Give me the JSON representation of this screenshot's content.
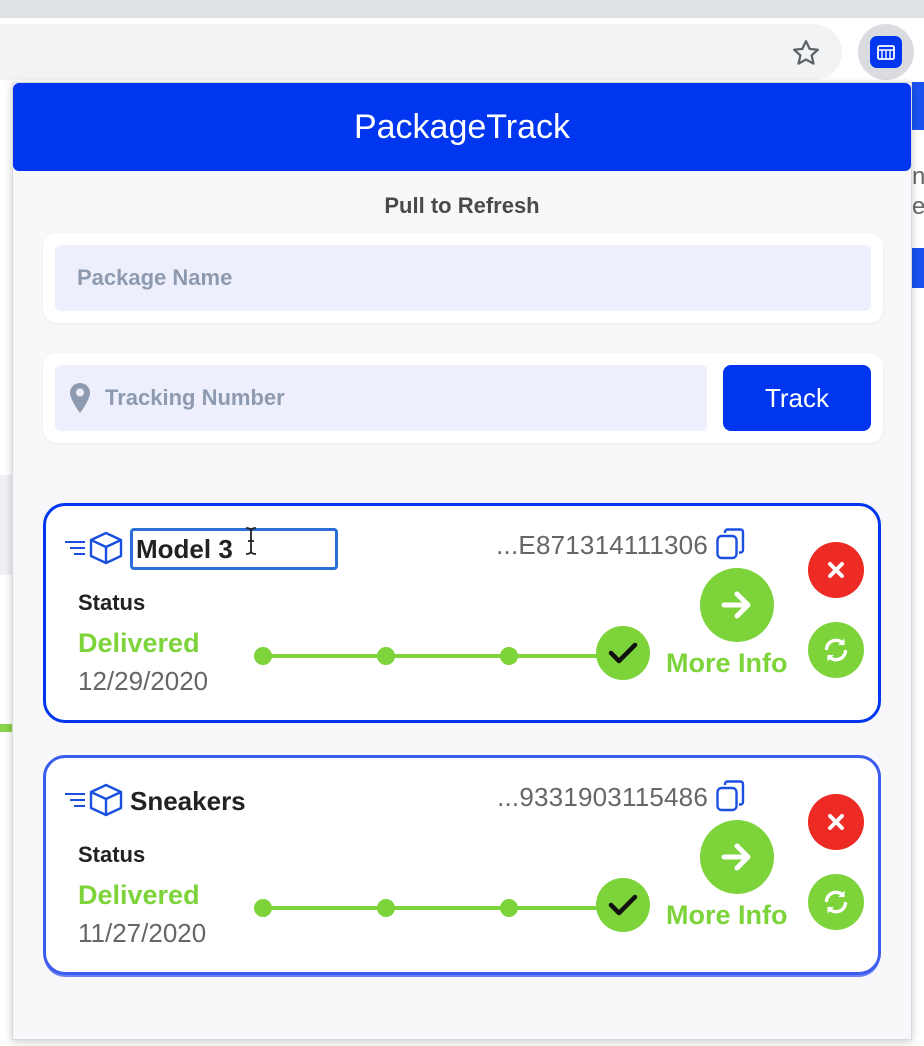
{
  "app": {
    "title": "PackageTrack",
    "refresh_hint": "Pull to Refresh"
  },
  "form": {
    "name_placeholder": "Package Name",
    "tracking_placeholder": "Tracking Number",
    "track_button": "Track"
  },
  "packages": [
    {
      "name": "Model 3",
      "tracking": "...E871314111306",
      "status_label": "Status",
      "status": "Delivered",
      "date": "12/29/2020",
      "more_info": "More Info",
      "editing": true
    },
    {
      "name": "Sneakers",
      "tracking": "...9331903115486",
      "status_label": "Status",
      "status": "Delivered",
      "date": "11/27/2020",
      "more_info": "More Info",
      "editing": false
    }
  ],
  "background_page": {
    "right_edge_text": "n\ne"
  },
  "colors": {
    "brand_blue": "#0036f0",
    "delivered_green": "#7dd33a",
    "delete_red": "#ee2a24"
  },
  "icons": [
    "star-icon",
    "extension-icon",
    "location-pin-icon",
    "menu-icon",
    "box-icon",
    "copy-icon",
    "check-icon",
    "arrow-right-icon",
    "close-icon",
    "refresh-icon",
    "text-cursor-icon"
  ]
}
